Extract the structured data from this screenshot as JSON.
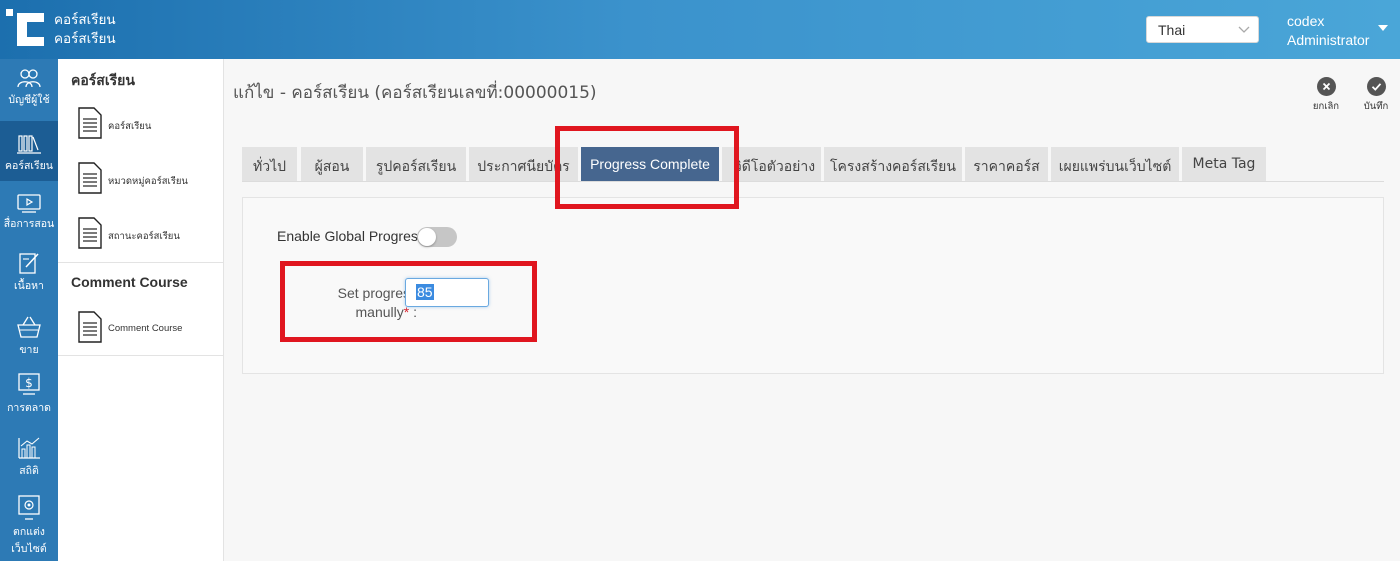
{
  "app": {
    "brand_line1": "คอร์สเรียน",
    "brand_line2": "คอร์สเรียน",
    "language": "Thai",
    "user_name": "codex",
    "user_role": "Administrator"
  },
  "sidenav": {
    "items": [
      {
        "label": "บัญชีผู้ใช้",
        "icon": "users-icon"
      },
      {
        "label": "คอร์สเรียน",
        "icon": "library-icon",
        "active": true
      },
      {
        "label": "สื่อการสอน",
        "icon": "video-icon"
      },
      {
        "label": "เนื้อหา",
        "icon": "edit-icon"
      },
      {
        "label": "ขาย",
        "icon": "basket-icon"
      },
      {
        "label": "การตลาด",
        "icon": "dollar-screen-icon"
      },
      {
        "label": "สถิติ",
        "icon": "stats-icon"
      },
      {
        "label": "ตกแต่ง",
        "label2": "เว็บไซต์",
        "icon": "settings-screen-icon"
      }
    ]
  },
  "submenu": {
    "section1_title": "คอร์สเรียน",
    "section1_items": [
      "คอร์สเรียน",
      "หมวดหมู่คอร์สเรียน",
      "สถานะคอร์สเรียน"
    ],
    "section2_title": "Comment Course",
    "section2_items": [
      "Comment Course"
    ]
  },
  "main": {
    "title": "แก้ไข - คอร์สเรียน (คอร์สเรียนเลขที่:00000015)",
    "actions": {
      "cancel": "ยกเลิก",
      "save": "บันทึก"
    },
    "tabs": [
      "ทั่วไป",
      "ผู้สอน",
      "รูปคอร์สเรียน",
      "ประกาศนียบัตร",
      "Progress Complete",
      "วิดีโอตัวอย่าง",
      "โครงสร้างคอร์สเรียน",
      "ราคาคอร์ส",
      "เผยแพร่บนเว็บไซต์",
      "Meta Tag"
    ],
    "active_tab": "Progress Complete",
    "form": {
      "global_progress_label": "Enable Global Progress",
      "global_progress_enabled": false,
      "set_progress_label_1": "Set progress",
      "set_progress_label_2": "manully",
      "required_mark": "*",
      "label_suffix": " :",
      "set_progress_value": "85"
    }
  },
  "colors": {
    "topbar": "#2d84c2",
    "sidenav": "#2d7ab5",
    "active_tab": "#46668f",
    "annotation": "#e0161f"
  }
}
